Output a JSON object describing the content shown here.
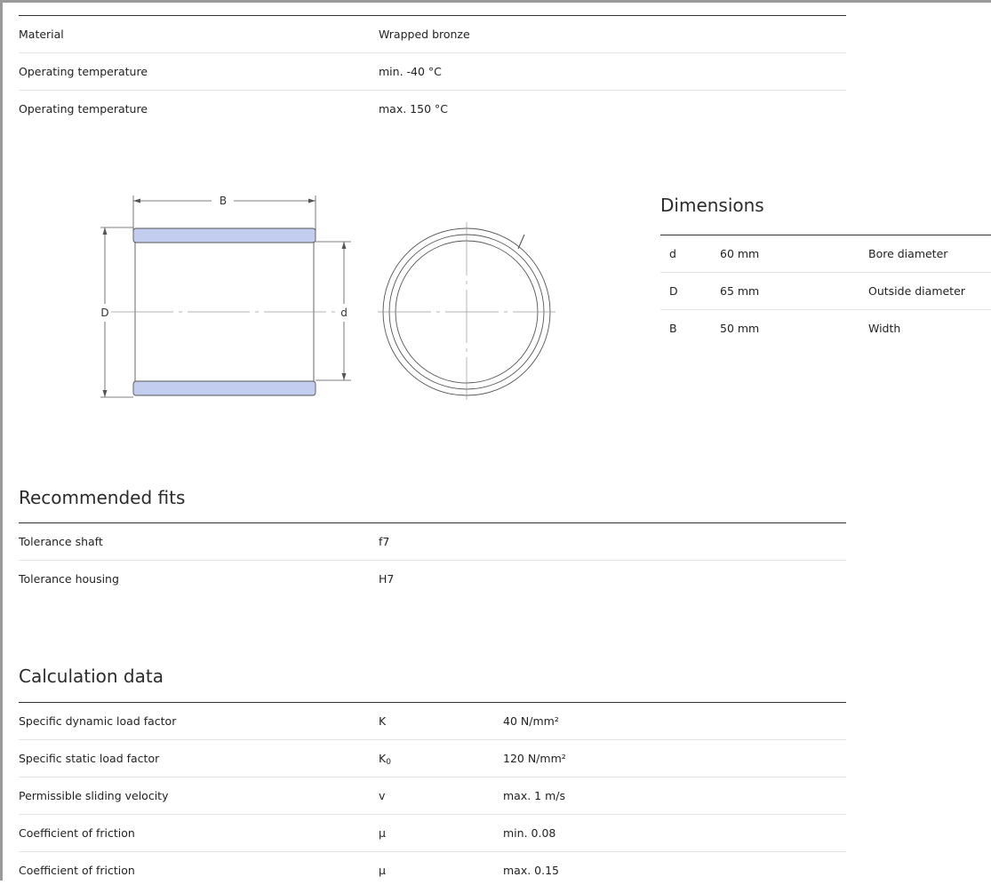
{
  "properties": [
    {
      "label": "Material",
      "value": "Wrapped bronze"
    },
    {
      "label": "Operating temperature",
      "value": "min. -40 °C"
    },
    {
      "label": "Operating temperature",
      "value": "max. 150 °C"
    }
  ],
  "drawing": {
    "label_B": "B",
    "label_D": "D",
    "label_d": "d"
  },
  "dimensions": {
    "title": "Dimensions",
    "rows": [
      {
        "symbol": "d",
        "value": "60 mm",
        "description": "Bore diameter"
      },
      {
        "symbol": "D",
        "value": "65 mm",
        "description": "Outside diameter"
      },
      {
        "symbol": "B",
        "value": "50 mm",
        "description": "Width"
      }
    ]
  },
  "fits": {
    "title": "Recommended fits",
    "rows": [
      {
        "label": "Tolerance shaft",
        "value": "f7"
      },
      {
        "label": "Tolerance housing",
        "value": "H7"
      }
    ]
  },
  "calculation": {
    "title": "Calculation data",
    "rows": [
      {
        "label": "Specific dynamic load factor",
        "symbol": "K",
        "symbol_sub": "",
        "value": "40 N/mm²"
      },
      {
        "label": "Specific static load factor",
        "symbol": "K",
        "symbol_sub": "0",
        "value": "120 N/mm²"
      },
      {
        "label": "Permissible sliding velocity",
        "symbol": "v",
        "symbol_sub": "",
        "value": "max. 1 m/s"
      },
      {
        "label": "Coefficient of friction",
        "symbol": "μ",
        "symbol_sub": "",
        "value": "min. 0.08"
      },
      {
        "label": "Coefficient of friction",
        "symbol": "μ",
        "symbol_sub": "",
        "value": "max. 0.15"
      }
    ]
  },
  "colors": {
    "bushing_wall_fill": "#c3cdf0",
    "rule": "#333333",
    "divider": "#e3e3e3"
  }
}
